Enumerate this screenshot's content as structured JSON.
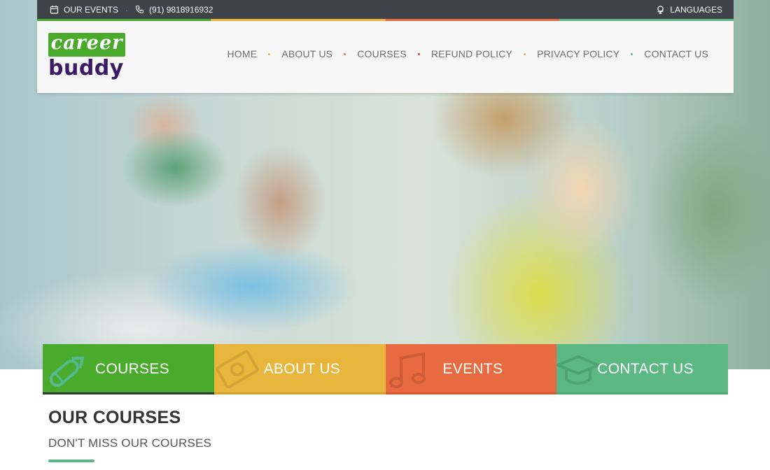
{
  "topbar": {
    "events_label": "OUR EVENTS",
    "phone": "(91) 9818916932",
    "languages_label": "LANGUAGES"
  },
  "logo": {
    "line1": "career",
    "line2": "buddy"
  },
  "nav": {
    "items": [
      {
        "label": "HOME",
        "dot_color": "#e8b53d"
      },
      {
        "label": "ABOUT US",
        "dot_color": "#e86a40"
      },
      {
        "label": "COURSES",
        "dot_color": "#d9453a"
      },
      {
        "label": "REFUND POLICY",
        "dot_color": "#e8b53d"
      },
      {
        "label": "PRIVACY POLICY",
        "dot_color": "#5bb882"
      },
      {
        "label": "CONTACT US"
      }
    ]
  },
  "features": [
    {
      "label": "COURSES",
      "color": "#4aaa2b",
      "icon": "pencil-icon"
    },
    {
      "label": "ABOUT US",
      "color": "#e8b53d",
      "icon": "money-icon"
    },
    {
      "label": "EVENTS",
      "color": "#e86a40",
      "icon": "music-note-icon"
    },
    {
      "label": "CONTACT US",
      "color": "#5bb882",
      "icon": "graduation-cap-icon"
    }
  ],
  "courses_section": {
    "title": "OUR COURSES",
    "subtitle": "DON'T MISS OUR COURSES"
  }
}
